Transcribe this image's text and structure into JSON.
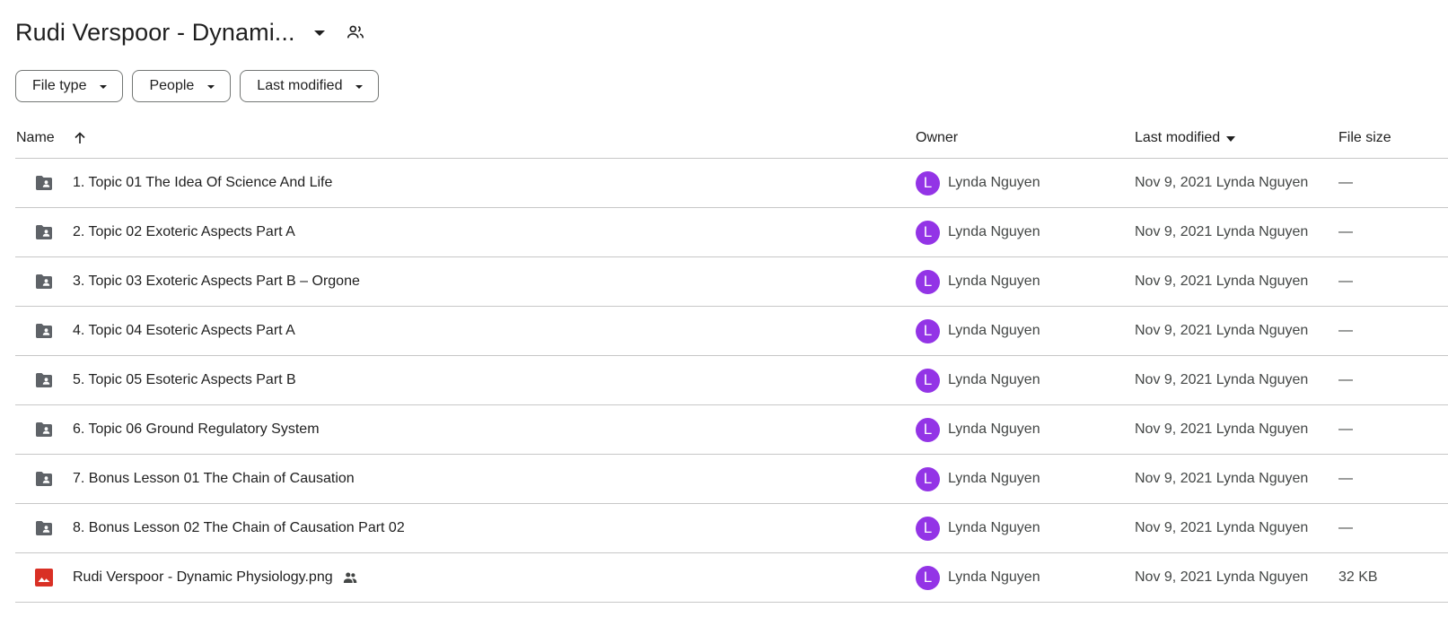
{
  "header": {
    "title": "Rudi Verspoor - Dynami...",
    "people_icon": "people-outline-icon"
  },
  "filters": [
    {
      "label": "File type"
    },
    {
      "label": "People"
    },
    {
      "label": "Last modified"
    }
  ],
  "table": {
    "columns": {
      "name": "Name",
      "owner": "Owner",
      "last_modified": "Last modified",
      "file_size": "File size"
    },
    "sort": {
      "column": "Name",
      "direction": "ascending"
    },
    "rows": [
      {
        "type": "shared-folder",
        "icon": "shared-folder-icon",
        "name": "1. Topic 01 The Idea Of Science And Life",
        "owner_initial": "L",
        "owner": "Lynda Nguyen",
        "modified": "Nov 9, 2021 Lynda Nguyen",
        "size": "—"
      },
      {
        "type": "shared-folder",
        "icon": "shared-folder-icon",
        "name": "2. Topic 02 Exoteric Aspects Part A",
        "owner_initial": "L",
        "owner": "Lynda Nguyen",
        "modified": "Nov 9, 2021 Lynda Nguyen",
        "size": "—"
      },
      {
        "type": "shared-folder",
        "icon": "shared-folder-icon",
        "name": "3. Topic 03 Exoteric Aspects Part B – Orgone",
        "owner_initial": "L",
        "owner": "Lynda Nguyen",
        "modified": "Nov 9, 2021 Lynda Nguyen",
        "size": "—"
      },
      {
        "type": "shared-folder",
        "icon": "shared-folder-icon",
        "name": "4. Topic 04 Esoteric Aspects Part A",
        "owner_initial": "L",
        "owner": "Lynda Nguyen",
        "modified": "Nov 9, 2021 Lynda Nguyen",
        "size": "—"
      },
      {
        "type": "shared-folder",
        "icon": "shared-folder-icon",
        "name": "5. Topic 05 Esoteric Aspects Part B",
        "owner_initial": "L",
        "owner": "Lynda Nguyen",
        "modified": "Nov 9, 2021 Lynda Nguyen",
        "size": "—"
      },
      {
        "type": "shared-folder",
        "icon": "shared-folder-icon",
        "name": "6. Topic 06 Ground Regulatory System",
        "owner_initial": "L",
        "owner": "Lynda Nguyen",
        "modified": "Nov 9, 2021 Lynda Nguyen",
        "size": "—"
      },
      {
        "type": "shared-folder",
        "icon": "shared-folder-icon",
        "name": "7. Bonus Lesson 01 The Chain of Causation",
        "owner_initial": "L",
        "owner": "Lynda Nguyen",
        "modified": "Nov 9, 2021 Lynda Nguyen",
        "size": "—"
      },
      {
        "type": "shared-folder",
        "icon": "shared-folder-icon",
        "name": "8. Bonus Lesson 02 The Chain of Causation Part 02",
        "owner_initial": "L",
        "owner": "Lynda Nguyen",
        "modified": "Nov 9, 2021 Lynda Nguyen",
        "size": "—"
      },
      {
        "type": "image",
        "icon": "image-file-icon",
        "name": "Rudi Verspoor - Dynamic Physiology.png",
        "shared": true,
        "owner_initial": "L",
        "owner": "Lynda Nguyen",
        "modified": "Nov 9, 2021 Lynda Nguyen",
        "size": "32 KB"
      }
    ]
  },
  "colors": {
    "avatar": "#9334e6",
    "folder_icon": "#5f6368",
    "image_icon": "#d93025",
    "divider": "#c7c7c7"
  }
}
